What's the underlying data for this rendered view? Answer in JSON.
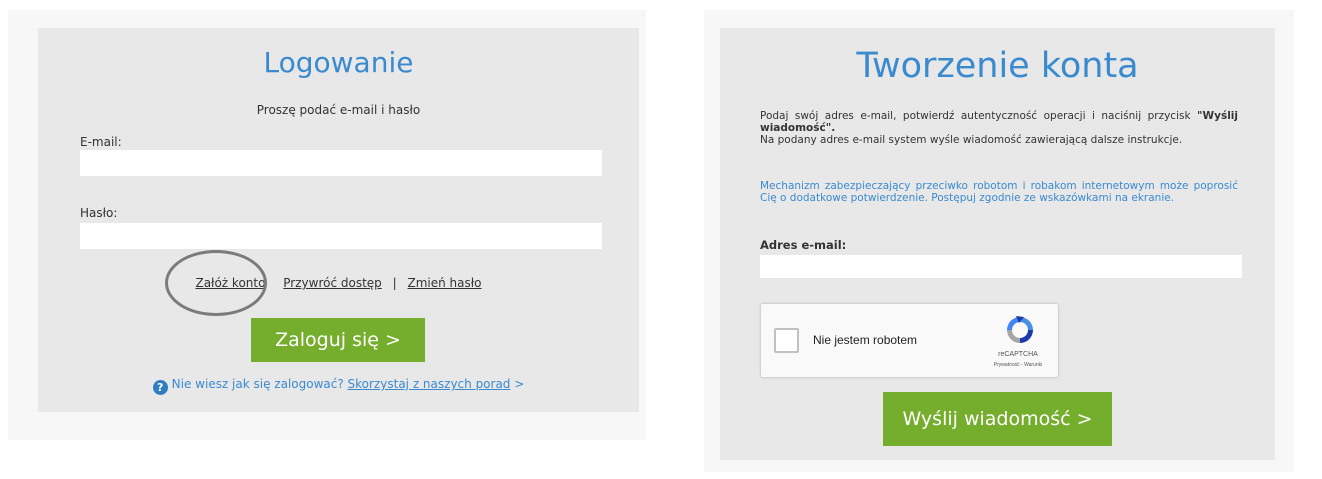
{
  "login": {
    "title": "Logowanie",
    "subtitle": "Proszę podać e-mail i hasło",
    "email_label": "E-mail:",
    "email_value": "",
    "password_label": "Hasło:",
    "password_value": "",
    "links": {
      "create_account": "Załóż konto",
      "restore_access": "Przywróć dostęp",
      "separator": "|",
      "change_password": "Zmień hasło"
    },
    "login_button": "Zaloguj się >",
    "help": {
      "icon": "question-circle-icon",
      "question": "Nie wiesz jak się zalogować?",
      "link": "Skorzystaj z naszych porad",
      "arrow": ">"
    }
  },
  "register": {
    "title": "Tworzenie konta",
    "instructions_part1": "Podaj swój adres e-mail, potwierdź autentyczność operacji i naciśnij przycisk",
    "instructions_bold": "\"Wyślij wiadomość\".",
    "instructions_part2": "Na podany adres e-mail system wyśle wiadomość zawierającą dalsze instrukcje.",
    "security_note": "Mechanizm zabezpieczający przeciwko robotom i robakom internetowym może poprosić Cię o dodatkowe potwierdzenie. Postępuj zgodnie ze wskazówkami na ekranie.",
    "email_label": "Adres e-mail:",
    "email_value": "",
    "captcha": {
      "label": "Nie jestem robotem",
      "brand": "reCAPTCHA",
      "terms": "Prywatność - Warunki",
      "icon": "recaptcha-logo-icon"
    },
    "send_button": "Wyślij wiadomość >"
  },
  "colors": {
    "panel_bg": "#e8e8e8",
    "title_blue": "#3a8ad0",
    "button_green": "#75ad2c",
    "highlight_ellipse": "#7b7b7b"
  }
}
